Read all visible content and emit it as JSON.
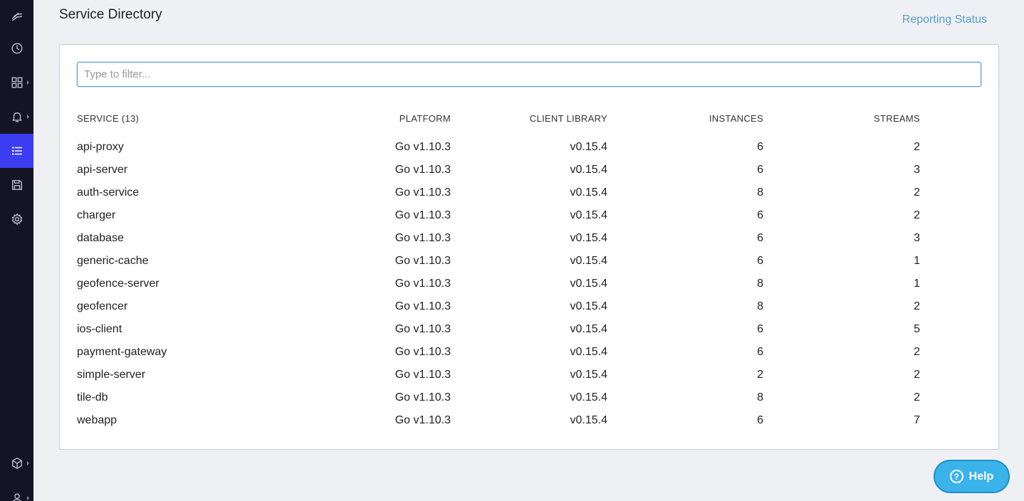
{
  "page": {
    "title": "Service Directory",
    "reporting_link": "Reporting Status"
  },
  "sidebar": {
    "items": [
      {
        "icon": "lightstep-logo-icon",
        "active": false
      },
      {
        "icon": "clock-icon",
        "active": false
      },
      {
        "icon": "dashboard-grid-icon",
        "active": false
      },
      {
        "icon": "bell-icon",
        "active": false
      },
      {
        "icon": "list-icon",
        "active": true
      },
      {
        "icon": "save-icon",
        "active": false
      },
      {
        "icon": "gear-icon",
        "active": false
      },
      {
        "icon": "package-icon",
        "active": false
      },
      {
        "icon": "user-icon",
        "active": false
      }
    ],
    "colors": {
      "background": "#141424",
      "active": "#3c3cf0",
      "icon": "#b8b8c8"
    }
  },
  "filter": {
    "placeholder": "Type to filter...",
    "value": ""
  },
  "table": {
    "headers": {
      "service": "SERVICE (13)",
      "platform": "PLATFORM",
      "client_library": "CLIENT LIBRARY",
      "instances": "INSTANCES",
      "streams": "STREAMS"
    },
    "rows": [
      {
        "service": "api-proxy",
        "platform": "Go v1.10.3",
        "client_library": "v0.15.4",
        "instances": "6",
        "streams": "2"
      },
      {
        "service": "api-server",
        "platform": "Go v1.10.3",
        "client_library": "v0.15.4",
        "instances": "6",
        "streams": "3"
      },
      {
        "service": "auth-service",
        "platform": "Go v1.10.3",
        "client_library": "v0.15.4",
        "instances": "8",
        "streams": "2"
      },
      {
        "service": "charger",
        "platform": "Go v1.10.3",
        "client_library": "v0.15.4",
        "instances": "6",
        "streams": "2"
      },
      {
        "service": "database",
        "platform": "Go v1.10.3",
        "client_library": "v0.15.4",
        "instances": "6",
        "streams": "3"
      },
      {
        "service": "generic-cache",
        "platform": "Go v1.10.3",
        "client_library": "v0.15.4",
        "instances": "6",
        "streams": "1"
      },
      {
        "service": "geofence-server",
        "platform": "Go v1.10.3",
        "client_library": "v0.15.4",
        "instances": "8",
        "streams": "1"
      },
      {
        "service": "geofencer",
        "platform": "Go v1.10.3",
        "client_library": "v0.15.4",
        "instances": "8",
        "streams": "2"
      },
      {
        "service": "ios-client",
        "platform": "Go v1.10.3",
        "client_library": "v0.15.4",
        "instances": "6",
        "streams": "5"
      },
      {
        "service": "payment-gateway",
        "platform": "Go v1.10.3",
        "client_library": "v0.15.4",
        "instances": "6",
        "streams": "2"
      },
      {
        "service": "simple-server",
        "platform": "Go v1.10.3",
        "client_library": "v0.15.4",
        "instances": "2",
        "streams": "2"
      },
      {
        "service": "tile-db",
        "platform": "Go v1.10.3",
        "client_library": "v0.15.4",
        "instances": "8",
        "streams": "2"
      },
      {
        "service": "webapp",
        "platform": "Go v1.10.3",
        "client_library": "v0.15.4",
        "instances": "6",
        "streams": "7"
      }
    ]
  },
  "help": {
    "label": "Help",
    "icon": "question-circle-icon",
    "color": "#3ab3ea"
  }
}
